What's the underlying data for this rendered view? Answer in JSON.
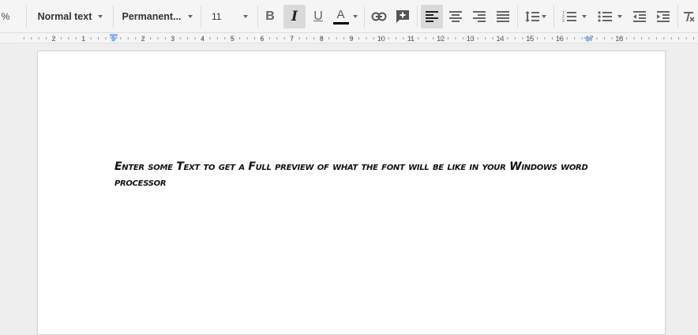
{
  "toolbar": {
    "zoom_suffix": "%",
    "style_select": "Normal text",
    "font_select": "Permanent...",
    "size_select": "11",
    "bold_label": "B",
    "italic_label": "I",
    "underline_label": "U",
    "text_color_label": "A",
    "text_color": "#000000",
    "active_state_color": "#dadada"
  },
  "ruler": {
    "labels": [
      "2",
      "1",
      "1",
      "2",
      "3",
      "4",
      "5",
      "6",
      "7",
      "8",
      "9",
      "10",
      "11",
      "12",
      "13",
      "14",
      "15",
      "16",
      "17",
      "18"
    ],
    "marker_color": "#8ab4f8"
  },
  "document": {
    "text": "Enter some Text to get a Full preview of what the font will be like in your Windows word processor"
  }
}
